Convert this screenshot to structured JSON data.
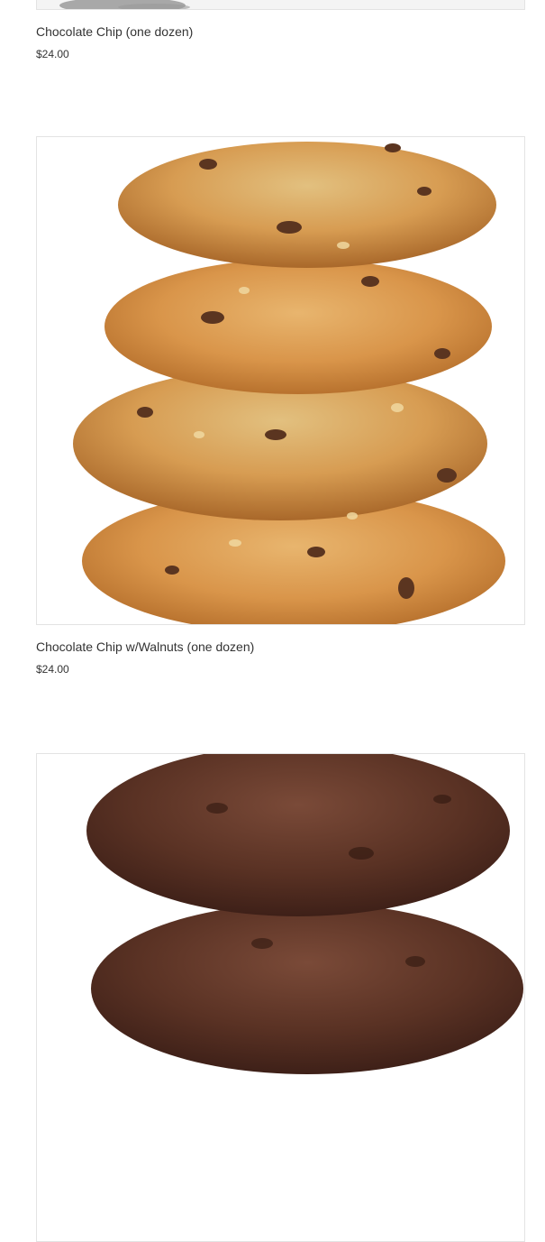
{
  "products": [
    {
      "title": "Chocolate Chip (one dozen)",
      "price": "$24.00",
      "image_icon": "chocolate-chip-cookie-image"
    },
    {
      "title": "Chocolate Chip w/Walnuts (one dozen)",
      "price": "$24.00",
      "image_icon": "chocolate-chip-walnut-cookie-stack-image"
    },
    {
      "image_icon": "double-chocolate-cookie-stack-image"
    }
  ],
  "colors": {
    "text": "#333333",
    "border": "#e3e3e3",
    "golden_cookie": "#d9954a",
    "dark_cookie": "#5a3224"
  }
}
